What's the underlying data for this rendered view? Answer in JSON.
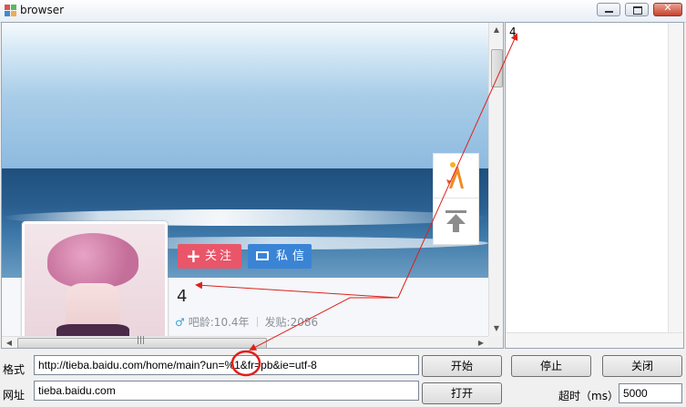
{
  "window": {
    "title": "browser"
  },
  "webpage": {
    "follow_label": "关注",
    "message_label": "私信",
    "username": "4",
    "gender_icon": "♂",
    "bar_age": "吧龄:10.4年",
    "posts": "发贴:2086"
  },
  "output": {
    "text": "4"
  },
  "form": {
    "format_label": "格式",
    "format_value": "http://tieba.baidu.com/home/main?un=%1&fr=pb&ie=utf-8",
    "url_label": "网址",
    "url_value": "tieba.baidu.com",
    "start_label": "开始",
    "stop_label": "停止",
    "close_label": "关闭",
    "open_label": "打开",
    "timeout_label": "超时（ms）",
    "timeout_value": "5000"
  },
  "colors": {
    "annotation": "#e0201a",
    "follow": "#e9566a",
    "message": "#3a84d6"
  }
}
